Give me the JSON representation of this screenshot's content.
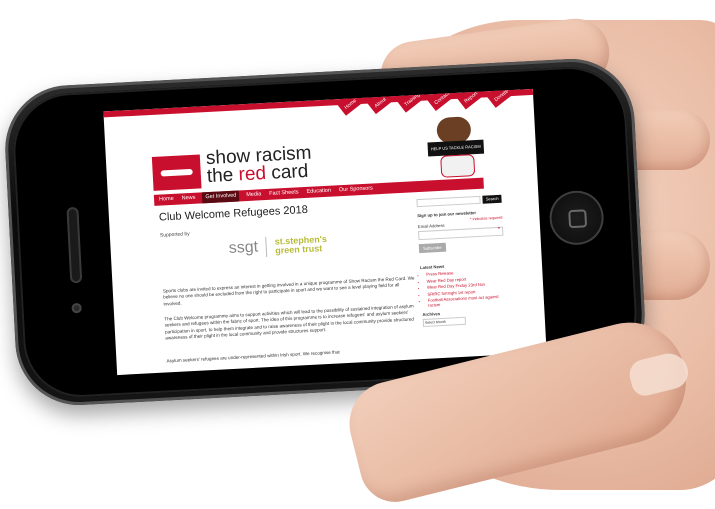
{
  "site": {
    "top_nav": [
      "Home",
      "About",
      "Training",
      "Contact",
      "Report",
      "Donate"
    ],
    "logo_line1": "show racism",
    "logo_line2_a": "the ",
    "logo_line2_b": "red",
    "logo_line2_c": " card",
    "mascot_banner": "HELP US TACKLE RACISM",
    "main_nav": [
      "Home",
      "News",
      "Get Involved",
      "Media",
      "Fact Sheets",
      "Education",
      "Our Sponsors"
    ],
    "page_title": "Club Welcome Refugees 2018",
    "supported_by": "Supported by",
    "sponsor_ssgt": "ssgt",
    "sponsor_stephen_1": "st.stephen's",
    "sponsor_stephen_2": "green trust",
    "para1": "Sports clubs are invited to express an interest in getting involved in a unique programme of Show Racism the Red Card. We believe no one should be excluded from the right to participate in sport and we want to see a level playing field for all involved.",
    "para2": "The Club Welcome programme aims to support activities which will lead to the possibility of sustained integration of asylum seekers and refugees within the fabric of sport. The idea of this programme is to increase refugees' and asylum seekers' participation in sport, to help them integrate and to raise awareness of their plight in the local community provide structured awareness of their plight in the local community and provide structures support.",
    "para3": "Asylum seekers' refugees are under-represented within Irish sport. We recognise that",
    "sidebar": {
      "search_button": "Search",
      "newsletter_heading": "Sign up to join our newsletter",
      "required_note": "* indicates required",
      "email_label": "Email Address",
      "subscribe_button": "Subscribe",
      "latest_news_heading": "Latest News",
      "news_items": [
        "Press Release",
        "Wear Red Day report",
        "Wear Red Day Friday 23rd Nov",
        "SRtRC fortnight 1st report",
        "Football Associations must act against racism"
      ],
      "archives_heading": "Archives",
      "archives_select": "Select Month"
    }
  },
  "colors": {
    "brand_red": "#c8102e"
  }
}
